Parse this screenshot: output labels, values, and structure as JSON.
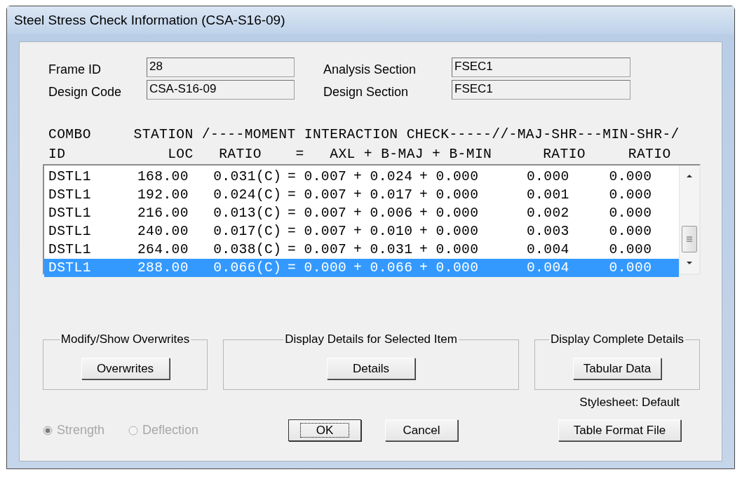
{
  "window": {
    "title": "Steel Stress Check Information (CSA-S16-09)"
  },
  "fields": [
    {
      "label": "Frame ID",
      "value": "28"
    },
    {
      "label": "Analysis Section",
      "value": "FSEC1"
    },
    {
      "label": "Design Code",
      "value": "CSA-S16-09"
    },
    {
      "label": "Design Section",
      "value": "FSEC1"
    }
  ],
  "table": {
    "header_lines": [
      "COMBO     STATION /----MOMENT INTERACTION CHECK-----//-MAJ-SHR---MIN-SHR-/",
      "ID            LOC   RATIO    =   AXL + B-MAJ + B-MIN      RATIO     RATIO"
    ],
    "rows": [
      {
        "selected": false,
        "cells": [
          "DSTL1",
          "168.00",
          "0.031(C)",
          "=",
          "0.007",
          "+",
          "0.024",
          "+",
          "0.000",
          "0.000",
          "0.000"
        ]
      },
      {
        "selected": false,
        "cells": [
          "DSTL1",
          "192.00",
          "0.024(C)",
          "=",
          "0.007",
          "+",
          "0.017",
          "+",
          "0.000",
          "0.001",
          "0.000"
        ]
      },
      {
        "selected": false,
        "cells": [
          "DSTL1",
          "216.00",
          "0.013(C)",
          "=",
          "0.007",
          "+",
          "0.006",
          "+",
          "0.000",
          "0.002",
          "0.000"
        ]
      },
      {
        "selected": false,
        "cells": [
          "DSTL1",
          "240.00",
          "0.017(C)",
          "=",
          "0.007",
          "+",
          "0.010",
          "+",
          "0.000",
          "0.003",
          "0.000"
        ]
      },
      {
        "selected": false,
        "cells": [
          "DSTL1",
          "264.00",
          "0.038(C)",
          "=",
          "0.007",
          "+",
          "0.031",
          "+",
          "0.000",
          "0.004",
          "0.000"
        ]
      },
      {
        "selected": true,
        "cells": [
          "DSTL1",
          "288.00",
          "0.066(C)",
          "=",
          "0.000",
          "+",
          "0.066",
          "+",
          "0.000",
          "0.004",
          "0.000"
        ]
      }
    ]
  },
  "groups": [
    {
      "title": "Modify/Show Overwrites",
      "button": "Overwrites"
    },
    {
      "title": "Display Details for Selected Item",
      "button": "Details"
    },
    {
      "title": "Display Complete Details",
      "button": "Tabular Data"
    }
  ],
  "stylesheet": "Stylesheet: Default",
  "radios": [
    {
      "label": "Strength",
      "selected": true,
      "disabled": true
    },
    {
      "label": "Deflection",
      "selected": false,
      "disabled": true
    }
  ],
  "buttons": [
    {
      "label": "OK",
      "focused": true
    },
    {
      "label": "Cancel",
      "focused": false
    }
  ],
  "table_format_button": "Table Format File"
}
